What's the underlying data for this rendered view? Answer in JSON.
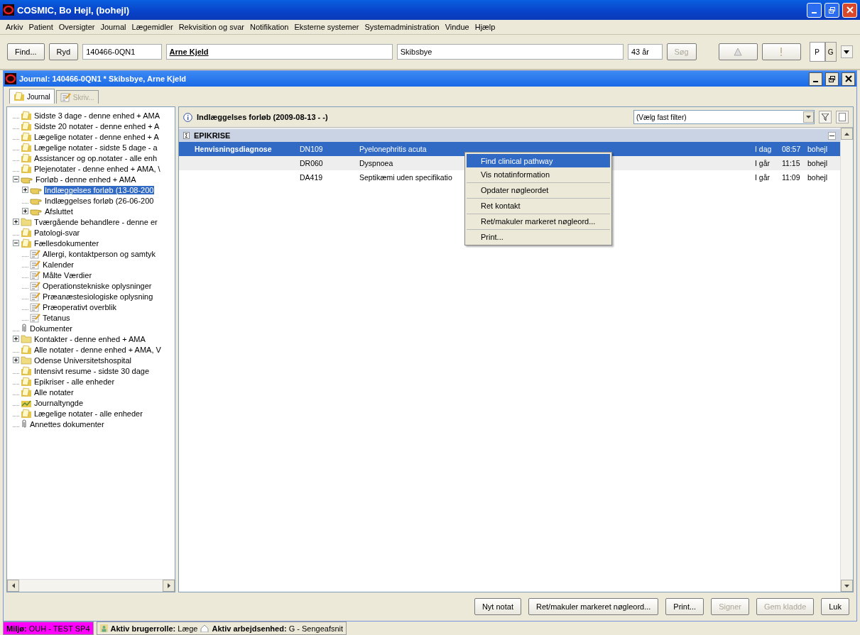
{
  "window": {
    "title": "COSMIC, Bo Hejl, (bohejl)"
  },
  "menu": [
    "Arkiv",
    "Patient",
    "Oversigter",
    "Journal",
    "Lægemidler",
    "Rekvisition og svar",
    "Notifikation",
    "Eksterne systemer",
    "Systemadministration",
    "Vindue",
    "Hjælp"
  ],
  "toolbar": {
    "find": "Find...",
    "clear": "Ryd",
    "cpr": "140466-0QN1",
    "first_name": "Arne Kjeld",
    "last_name": "Skibsbye",
    "age": "43 år",
    "search": "Søg",
    "search_disabled": true,
    "exclaim_disabled": true,
    "panel_tabs": [
      {
        "label": "P",
        "selected": true
      },
      {
        "label": "G",
        "selected": false
      }
    ]
  },
  "journal_window": {
    "title": "Journal: 140466-0QN1 * Skibsbye, Arne Kjeld"
  },
  "tabs": [
    {
      "label": "Journal",
      "selected": true,
      "disabled": false
    },
    {
      "label": "Skriv...",
      "selected": false,
      "disabled": true
    }
  ],
  "tree": [
    {
      "label": "Sidste 3 dage - denne enhed + AMA",
      "kind": "notes",
      "selected": false
    },
    {
      "label": "Sidste 20 notater - denne enhed + A",
      "kind": "notes",
      "selected": false
    },
    {
      "label": "Lægelige notater - denne enhed + A",
      "kind": "notes",
      "selected": false
    },
    {
      "label": "Lægelige notater - sidste 5 dage - a",
      "kind": "notes",
      "selected": false
    },
    {
      "label": "Assistancer og op.notater - alle enh",
      "kind": "notes",
      "selected": false
    },
    {
      "label": "Plejenotater - denne enhed + AMA, \\",
      "kind": "notes",
      "selected": false
    },
    {
      "label": "Forløb - denne enhed + AMA",
      "kind": "hand",
      "selected": false,
      "expanded": true,
      "children": [
        {
          "label": "Indlæggelses forløb (13-08-200",
          "kind": "hand",
          "selected": true,
          "expanded": false
        },
        {
          "label": "Indlæggelses forløb (26-06-200",
          "kind": "hand",
          "selected": false
        },
        {
          "label": "Afsluttet",
          "kind": "hand",
          "selected": false,
          "expanded": false
        }
      ]
    },
    {
      "label": "Tværgående behandlere - denne er",
      "kind": "folder",
      "selected": false,
      "expanded": false
    },
    {
      "label": "Patologi-svar",
      "kind": "notes",
      "selected": false
    },
    {
      "label": "Fællesdokumenter",
      "kind": "notes",
      "selected": false,
      "expanded": true,
      "children": [
        {
          "label": "Allergi, kontaktperson og samtyk",
          "kind": "form",
          "selected": false
        },
        {
          "label": "Kalender",
          "kind": "form",
          "selected": false
        },
        {
          "label": "Målte Værdier",
          "kind": "form",
          "selected": false
        },
        {
          "label": "Operationstekniske oplysninger",
          "kind": "form",
          "selected": false
        },
        {
          "label": "Præanæstesiologiske oplysning",
          "kind": "form",
          "selected": false
        },
        {
          "label": "Præoperativt overblik",
          "kind": "form",
          "selected": false
        },
        {
          "label": "Tetanus",
          "kind": "form",
          "selected": false
        }
      ]
    },
    {
      "label": "Dokumenter",
      "kind": "clip",
      "selected": false
    },
    {
      "label": "Kontakter - denne enhed + AMA",
      "kind": "folder",
      "selected": false,
      "expanded": false
    },
    {
      "label": "Alle notater - denne enhed + AMA, V",
      "kind": "notes",
      "selected": false
    },
    {
      "label": "Odense Universitetshospital",
      "kind": "folder",
      "selected": false,
      "expanded": false
    },
    {
      "label": "Intensivt resume - sidste 30 dage",
      "kind": "notes",
      "selected": false
    },
    {
      "label": "Epikriser - alle enheder",
      "kind": "notes",
      "selected": false
    },
    {
      "label": "Alle notater",
      "kind": "notes",
      "selected": false
    },
    {
      "label": "Journaltyngde",
      "kind": "chart",
      "selected": false
    },
    {
      "label": "Lægelige notater - alle enheder",
      "kind": "notes",
      "selected": false
    },
    {
      "label": "Annettes dokumenter",
      "kind": "clip",
      "selected": false
    }
  ],
  "panel": {
    "title": "Indlæggelses forløb (2009-08-13 - -)",
    "filter": "(Vælg fast filter)"
  },
  "group": {
    "title": "EPIKRISE",
    "expanded": true
  },
  "rows": [
    {
      "label": "Henvisningsdiagnose",
      "code": "DN109",
      "text": "Pyelonephritis acuta",
      "day": "I dag",
      "time": "08:57",
      "user": "bohejl",
      "selected": true
    },
    {
      "code": "DR060",
      "text": "Dyspnoea",
      "day": "I går",
      "time": "11:15",
      "user": "bohejl",
      "selected": false
    },
    {
      "code": "DA419",
      "text": "Septikæmi uden specifikatio",
      "day": "I går",
      "time": "11:09",
      "user": "bohejl",
      "selected": false
    }
  ],
  "context_menu": [
    {
      "label": "Find clinical pathway",
      "selected": true,
      "separator_before": false
    },
    {
      "label": "Vis notatinformation",
      "selected": false,
      "separator_before": false
    },
    {
      "label": "Opdater nøgleordet",
      "selected": false,
      "separator_before": true
    },
    {
      "label": "Ret kontakt",
      "selected": false,
      "separator_before": true
    },
    {
      "label": "Ret/makuler markeret nøgleord...",
      "selected": false,
      "separator_before": true
    },
    {
      "label": "Print...",
      "selected": false,
      "separator_before": true
    }
  ],
  "buttons": [
    {
      "label": "Nyt notat",
      "disabled": false
    },
    {
      "label": "Ret/makuler markeret nøgleord...",
      "disabled": false
    },
    {
      "label": "Print...",
      "disabled": false
    },
    {
      "label": "Signer",
      "disabled": true
    },
    {
      "label": "Gem kladde",
      "disabled": true
    },
    {
      "label": "Luk",
      "disabled": false
    }
  ],
  "status_bar": {
    "environment": "**Miljø:** OUH - TEST SP4",
    "role": "**Aktiv brugerrolle:** Læge",
    "unit": "**Aktiv arbejdsenhed:** G - Sengeafsnit"
  }
}
